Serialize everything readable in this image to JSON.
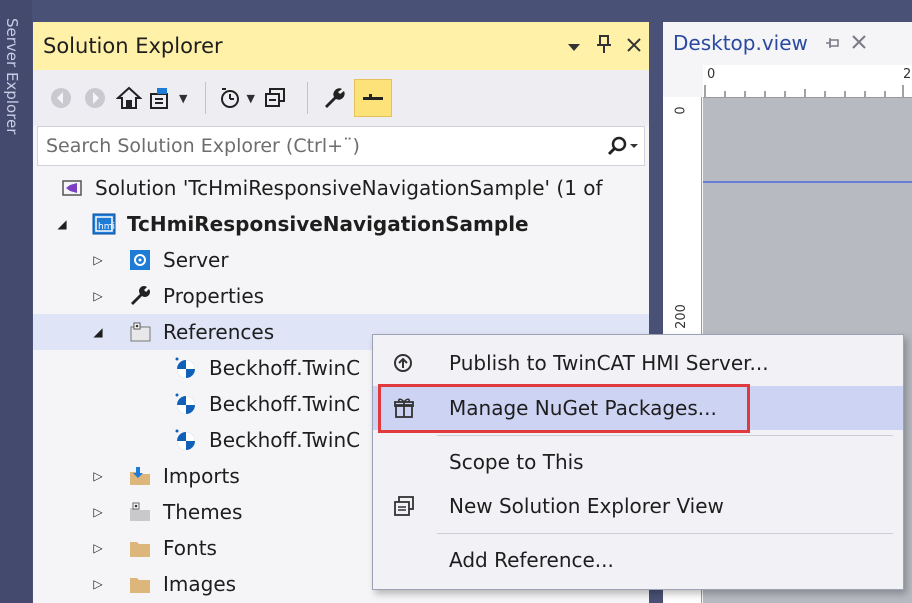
{
  "left_strip": {
    "label": "Server Explorer"
  },
  "solution_explorer": {
    "title": "Solution Explorer",
    "title_controls": {
      "dropdown": "▼",
      "pin": "📌",
      "close": "✕"
    },
    "search": {
      "placeholder": "Search Solution Explorer (Ctrl+¨)"
    },
    "tree": {
      "solution": "Solution 'TcHmiResponsiveNavigationSample' (1 of",
      "project": "TcHmiResponsiveNavigationSample",
      "items": [
        "Server",
        "Properties",
        "References",
        "Beckhoff.TwinC",
        "Beckhoff.TwinC",
        "Beckhoff.TwinC",
        "Imports",
        "Themes",
        "Fonts",
        "Images"
      ]
    }
  },
  "designer": {
    "tab_title": "Desktop.view",
    "ruler_top_labels": [
      "0",
      "2"
    ],
    "ruler_left_labels": [
      "0",
      "200"
    ]
  },
  "context_menu": {
    "items": [
      "Publish to TwinCAT HMI Server...",
      "Manage NuGet Packages...",
      "Scope to This",
      "New Solution Explorer View",
      "Add Reference..."
    ]
  },
  "colors": {
    "highlight_box": "#e0393e",
    "title_active": "#fff1a8",
    "menu_hover": "#cdd3f2",
    "accent_blue": "#1e7bd6"
  }
}
